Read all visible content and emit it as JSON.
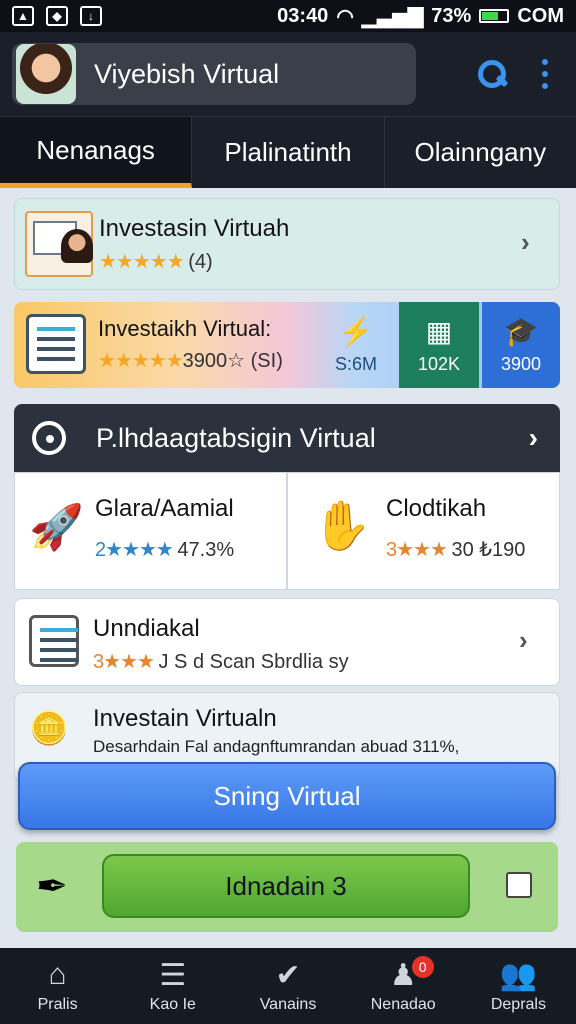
{
  "status_bar": {
    "time": "03:40",
    "battery": "73%",
    "carrier": "COM"
  },
  "app_bar": {
    "title": "Viyebish Virtual"
  },
  "tabs": [
    {
      "label": "Nenanags",
      "active": true
    },
    {
      "label": "Plalinatinth",
      "active": false
    },
    {
      "label": "Olainngany",
      "active": false
    }
  ],
  "cards": {
    "card1": {
      "title": "Investasin Virtuah",
      "stars": "★★★★★",
      "rating_text": "(4)"
    },
    "card2": {
      "title": "Investaikh Virtual:",
      "stars": "★★★★★",
      "rating_text": "3900☆ (SI)",
      "stats": [
        {
          "icon": "flash-icon",
          "value": "S:6M"
        },
        {
          "icon": "chart-icon",
          "value": "102K"
        },
        {
          "icon": "cap-icon",
          "value": "3900"
        }
      ]
    },
    "section": {
      "title": "P.lhdaagtabsigin Virtual"
    },
    "grid": [
      {
        "title": "Glara/Aamial",
        "stars": "★★★★",
        "prefix": "2",
        "value": "47.3%"
      },
      {
        "title": "Clodtikah",
        "stars": "★★★",
        "prefix": "3",
        "value": "30 ₺190"
      }
    ],
    "card4": {
      "title": "Unndiakal",
      "stars": "★★★",
      "prefix": "3",
      "subtitle": "J S d Scan Sbrdlia sy"
    },
    "card5": {
      "title": "Investain Virtualn",
      "description": "Desarhdain Fal andagnftumrandan abuad 311%,"
    }
  },
  "buttons": {
    "primary": "Sning Virtual",
    "secondary": "Idnadain 3"
  },
  "bottom_nav": [
    {
      "icon": "home-icon",
      "label": "Pralis"
    },
    {
      "icon": "list-icon",
      "label": "Kao Ie"
    },
    {
      "icon": "check-icon",
      "label": "Vanains"
    },
    {
      "icon": "notification-icon",
      "label": "Nenadao",
      "badge": "0"
    },
    {
      "icon": "people-icon",
      "label": "Deprals"
    }
  ],
  "colors": {
    "accent_tab": "#f2a12e",
    "primary_button": "#3877e6",
    "secondary_button": "#4fa62e",
    "stars": "#f5a623"
  }
}
